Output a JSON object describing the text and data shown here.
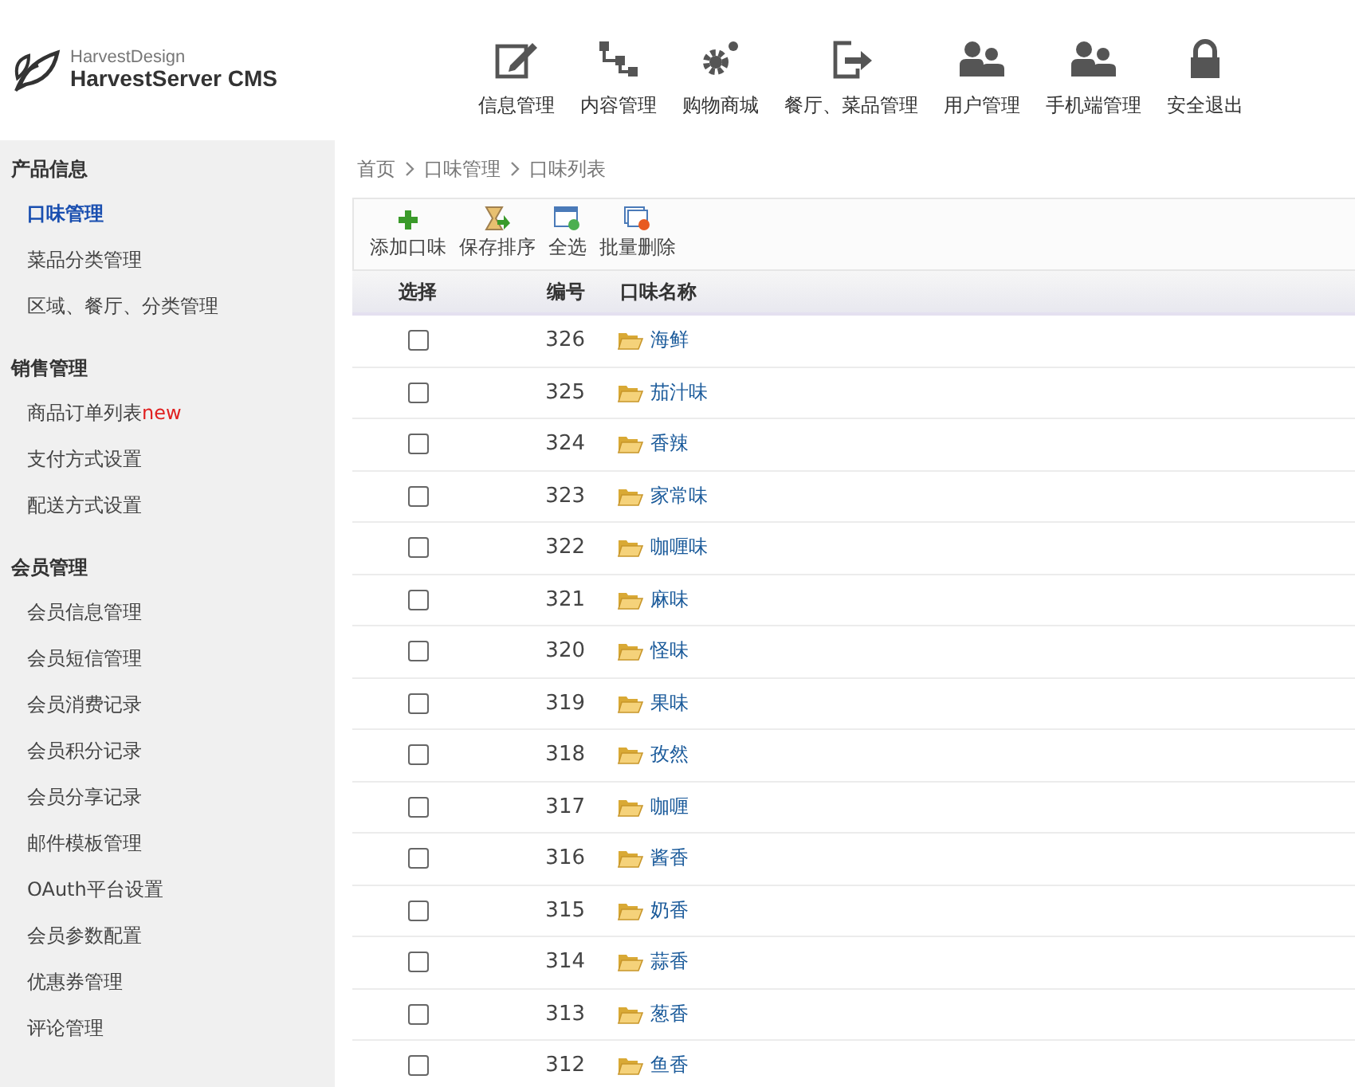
{
  "logo": {
    "small": "HarvestDesign",
    "title": "HarvestServer CMS"
  },
  "nav": [
    {
      "label": "信息管理",
      "kind": "edit"
    },
    {
      "label": "内容管理",
      "kind": "tree"
    },
    {
      "label": "购物商城",
      "kind": "gears"
    },
    {
      "label": "餐厅、菜品管理",
      "kind": "export"
    },
    {
      "label": "用户管理",
      "kind": "users"
    },
    {
      "label": "手机端管理",
      "kind": "users"
    },
    {
      "label": "安全退出",
      "kind": "lock"
    }
  ],
  "sidebar": [
    {
      "title": "产品信息",
      "items": [
        {
          "label": "口味管理",
          "selected": true
        },
        {
          "label": "菜品分类管理",
          "selected": false
        },
        {
          "label": "区域、餐厅、分类管理",
          "selected": false
        }
      ]
    },
    {
      "title": "销售管理",
      "items": [
        {
          "label": "商品订单列表",
          "badge": "new",
          "selected": false
        },
        {
          "label": "支付方式设置",
          "selected": false
        },
        {
          "label": "配送方式设置",
          "selected": false
        }
      ]
    },
    {
      "title": "会员管理",
      "items": [
        {
          "label": "会员信息管理",
          "selected": false
        },
        {
          "label": "会员短信管理",
          "selected": false
        },
        {
          "label": "会员消费记录",
          "selected": false
        },
        {
          "label": "会员积分记录",
          "selected": false
        },
        {
          "label": "会员分享记录",
          "selected": false
        },
        {
          "label": "邮件模板管理",
          "selected": false
        },
        {
          "label": "OAuth平台设置",
          "selected": false
        },
        {
          "label": "会员参数配置",
          "selected": false
        },
        {
          "label": "优惠券管理",
          "selected": false
        },
        {
          "label": "评论管理",
          "selected": false
        }
      ]
    }
  ],
  "breadcrumb": [
    "首页",
    "口味管理",
    "口味列表"
  ],
  "toolbar": [
    {
      "label": "添加口味",
      "kind": "add"
    },
    {
      "label": "保存排序",
      "kind": "save"
    },
    {
      "label": "全选",
      "kind": "select"
    },
    {
      "label": "批量删除",
      "kind": "delete"
    }
  ],
  "table": {
    "columns": [
      "选择",
      "编号",
      "口味名称"
    ],
    "rows": [
      {
        "id": "326",
        "name": "海鲜",
        "checked": false
      },
      {
        "id": "325",
        "name": "茄汁味",
        "checked": false
      },
      {
        "id": "324",
        "name": "香辣",
        "checked": false
      },
      {
        "id": "323",
        "name": "家常味",
        "checked": false
      },
      {
        "id": "322",
        "name": "咖喱味",
        "checked": false
      },
      {
        "id": "321",
        "name": "麻味",
        "checked": false
      },
      {
        "id": "320",
        "name": "怪味",
        "checked": false
      },
      {
        "id": "319",
        "name": "果味",
        "checked": false
      },
      {
        "id": "318",
        "name": "孜然",
        "checked": false
      },
      {
        "id": "317",
        "name": "咖喱",
        "checked": false
      },
      {
        "id": "316",
        "name": "酱香",
        "checked": false
      },
      {
        "id": "315",
        "name": "奶香",
        "checked": false
      },
      {
        "id": "314",
        "name": "蒜香",
        "checked": false
      },
      {
        "id": "313",
        "name": "葱香",
        "checked": false
      },
      {
        "id": "312",
        "name": "鱼香",
        "checked": false
      }
    ]
  }
}
